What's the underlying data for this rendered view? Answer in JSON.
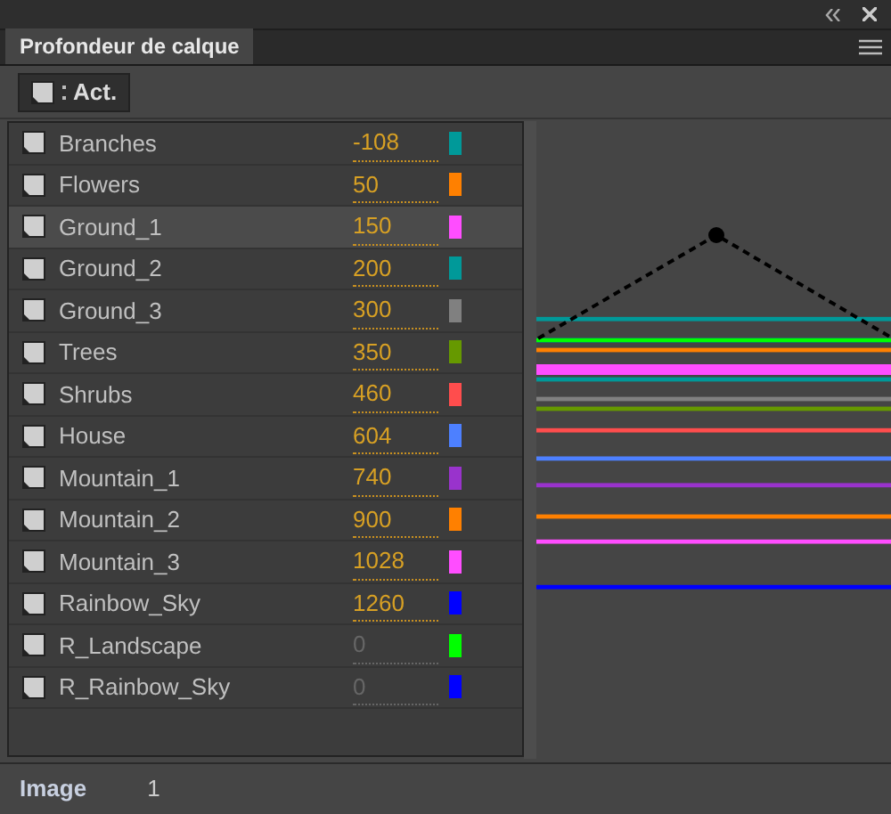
{
  "panel": {
    "title": "Profondeur de calque",
    "selected": true
  },
  "toolbar": {
    "button": "Act."
  },
  "layers": [
    {
      "name": "Branches",
      "depth": "-108",
      "color": "#009999",
      "selected": false,
      "active": true
    },
    {
      "name": "Flowers",
      "depth": "50",
      "color": "#ff8000",
      "selected": false,
      "active": true
    },
    {
      "name": "Ground_1",
      "depth": "150",
      "color": "#ff4dff",
      "selected": true,
      "active": true
    },
    {
      "name": "Ground_2",
      "depth": "200",
      "color": "#009999",
      "selected": false,
      "active": true
    },
    {
      "name": "Ground_3",
      "depth": "300",
      "color": "#808080",
      "selected": false,
      "active": true
    },
    {
      "name": "Trees",
      "depth": "350",
      "color": "#669900",
      "selected": false,
      "active": true
    },
    {
      "name": "Shrubs",
      "depth": "460",
      "color": "#ff4d4d",
      "selected": false,
      "active": true
    },
    {
      "name": "House",
      "depth": "604",
      "color": "#4d80ff",
      "selected": false,
      "active": true
    },
    {
      "name": "Mountain_1",
      "depth": "740",
      "color": "#9933cc",
      "selected": false,
      "active": true
    },
    {
      "name": "Mountain_2",
      "depth": "900",
      "color": "#ff8000",
      "selected": false,
      "active": true
    },
    {
      "name": "Mountain_3",
      "depth": "1028",
      "color": "#ff4dff",
      "selected": false,
      "active": true
    },
    {
      "name": "Rainbow_Sky",
      "depth": "1260",
      "color": "#0000ff",
      "selected": false,
      "active": true
    },
    {
      "name": "R_Landscape",
      "depth": "0",
      "color": "#00ff00",
      "selected": false,
      "active": false
    },
    {
      "name": "R_Rainbow_Sky",
      "depth": "0",
      "color": "#0000ff",
      "selected": false,
      "active": false
    }
  ],
  "footer": {
    "label": "Image",
    "value": "1"
  }
}
